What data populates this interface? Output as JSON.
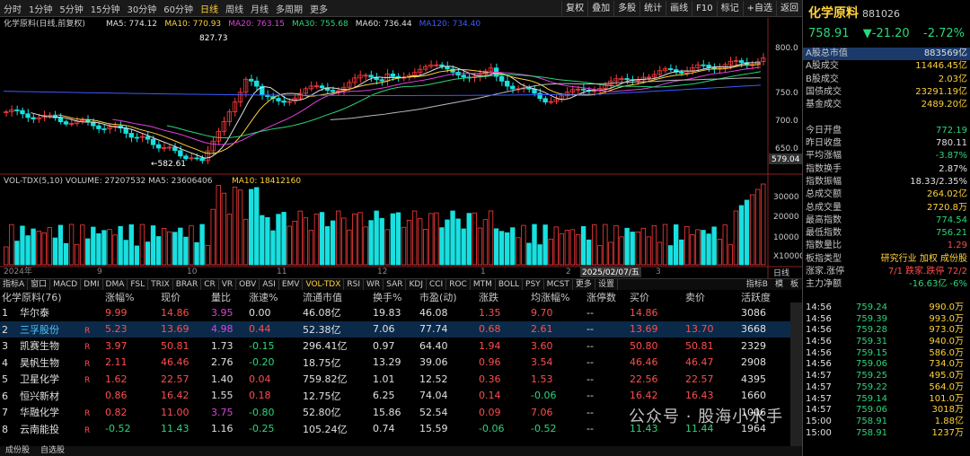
{
  "toolbar": {
    "timeframes": [
      "分时",
      "1分钟",
      "5分钟",
      "15分钟",
      "30分钟",
      "60分钟",
      "日线",
      "周线",
      "月线",
      "多周期",
      "更多"
    ],
    "active": 6,
    "tools": [
      "复权",
      "叠加",
      "多股",
      "统计",
      "画线",
      "F10",
      "标记",
      "+自选",
      "返回"
    ]
  },
  "chart": {
    "legend_main": "化学原料(日线,前复权)",
    "ma_labels": [
      {
        "text": "MA5: 774.12",
        "color": "#e0e0e0"
      },
      {
        "text": "MA10: 770.93",
        "color": "#ffd23a"
      },
      {
        "text": "MA20: 763.15",
        "color": "#e040e0"
      },
      {
        "text": "MA30: 755.68",
        "color": "#2bd67b"
      },
      {
        "text": "MA60: 736.44",
        "color": "#e0e0e0"
      },
      {
        "text": "MA120: 734.40",
        "color": "#3c5cff"
      }
    ],
    "high_label": "827.73",
    "low_label": "582.61",
    "y_ticks": [
      "800.0",
      "750.0",
      "700.0",
      "650.0",
      "600.0"
    ],
    "current_price": "579.04",
    "vol_legend": "VOL-TDX(5,10)  VOLUME: 27207532  MA5: 23606406",
    "vol_ma10": "MA10: 18412160",
    "vol_ticks": [
      "30000",
      "20000",
      "10000",
      "X10000"
    ],
    "x_labels": [
      "2024年",
      "9",
      "10",
      "11",
      "12",
      "1",
      "2",
      "3"
    ],
    "date_tag": "2025/02/07/五",
    "indicator_tabs": [
      "指标A",
      "窗口",
      "MACD",
      "DMI",
      "DMA",
      "FSL",
      "TRIX",
      "BRAR",
      "CR",
      "VR",
      "OBV",
      "ASI",
      "EMV",
      "VOL-TDX",
      "RSI",
      "WR",
      "SAR",
      "KDJ",
      "CCI",
      "ROC",
      "MTM",
      "BOLL",
      "PSY",
      "MCST",
      "更多",
      "设置"
    ],
    "right_tabs": [
      "指标B",
      "模",
      "板"
    ],
    "day_tab": "日线"
  },
  "stock": {
    "name": "化学原料",
    "code": "881026",
    "price": "758.91",
    "change": "▼-21.20",
    "pct": "-2.72%"
  },
  "stats": [
    {
      "k": "A股总市值",
      "v": "883569亿",
      "c": "wht",
      "hl": true
    },
    {
      "k": "A股成交",
      "v": "11446.45亿",
      "c": "yel"
    },
    {
      "k": "B股成交",
      "v": "2.03亿",
      "c": "yel"
    },
    {
      "k": "国债成交",
      "v": "23291.19亿",
      "c": "yel"
    },
    {
      "k": "基金成交",
      "v": "2489.20亿",
      "c": "yel"
    },
    {
      "k": "",
      "v": "",
      "c": "wht"
    },
    {
      "k": "今日开盘",
      "v": "772.19",
      "c": "grn"
    },
    {
      "k": "昨日收盘",
      "v": "780.11",
      "c": "wht"
    },
    {
      "k": "平均涨幅",
      "v": "-3.87%",
      "c": "grn"
    },
    {
      "k": "指数换手",
      "v": "2.87%",
      "c": "wht"
    },
    {
      "k": "指数振幅",
      "v": "18.33/2.35%",
      "c": "wht"
    },
    {
      "k": "总成交额",
      "v": "264.02亿",
      "c": "yel"
    },
    {
      "k": "总成交量",
      "v": "2720.8万",
      "c": "yel"
    },
    {
      "k": "最高指数",
      "v": "774.54",
      "c": "grn"
    },
    {
      "k": "最低指数",
      "v": "756.21",
      "c": "grn"
    },
    {
      "k": "指数量比",
      "v": "1.29",
      "c": "red"
    },
    {
      "k": "板指类型",
      "v": "研究行业 加权 成份股",
      "c": "yel"
    },
    {
      "k": "涨家.涨停",
      "v": "7/1  跌家.跌停  72/2",
      "c": "red"
    },
    {
      "k": "主力净额",
      "v": "-16.63亿  -6%",
      "c": "grn"
    }
  ],
  "table": {
    "headers": [
      "化学原料(76)",
      "涨幅%",
      "现价",
      "量比",
      "涨速%",
      "流通市值",
      "换手%",
      "市盈(动)",
      "涨跌",
      "均涨幅%",
      "涨停数",
      "买价",
      "卖价",
      "活跃度"
    ],
    "rows": [
      {
        "n": "1",
        "name": "华尔泰",
        "r": "",
        "v": [
          "9.99",
          "14.86",
          "3.95",
          "0.00",
          "46.08亿",
          "19.83",
          "46.08",
          "1.35",
          "9.70",
          "--",
          "14.86",
          "",
          "3086"
        ],
        "c": [
          "red",
          "red",
          "mag",
          "wht",
          "wht",
          "wht",
          "wht",
          "red",
          "red",
          "wht",
          "red",
          "wht",
          "wht"
        ]
      },
      {
        "n": "2",
        "name": "三孚股份",
        "r": "R",
        "v": [
          "5.23",
          "13.69",
          "4.98",
          "0.44",
          "52.38亿",
          "7.06",
          "77.74",
          "0.68",
          "2.61",
          "--",
          "13.69",
          "13.70",
          "3668"
        ],
        "c": [
          "red",
          "red",
          "mag",
          "red",
          "wht",
          "wht",
          "wht",
          "red",
          "red",
          "wht",
          "red",
          "red",
          "wht"
        ],
        "sel": true
      },
      {
        "n": "3",
        "name": "凯赛生物",
        "r": "R",
        "v": [
          "3.97",
          "50.81",
          "1.73",
          "-0.15",
          "296.41亿",
          "0.97",
          "64.40",
          "1.94",
          "3.60",
          "--",
          "50.80",
          "50.81",
          "2329"
        ],
        "c": [
          "red",
          "red",
          "wht",
          "grn",
          "wht",
          "wht",
          "wht",
          "red",
          "red",
          "wht",
          "red",
          "red",
          "wht"
        ]
      },
      {
        "n": "4",
        "name": "昊帆生物",
        "r": "R",
        "v": [
          "2.11",
          "46.46",
          "2.76",
          "-0.20",
          "18.75亿",
          "13.29",
          "39.06",
          "0.96",
          "3.54",
          "--",
          "46.46",
          "46.47",
          "2908"
        ],
        "c": [
          "red",
          "red",
          "wht",
          "grn",
          "wht",
          "wht",
          "wht",
          "red",
          "red",
          "wht",
          "red",
          "red",
          "wht"
        ]
      },
      {
        "n": "5",
        "name": "卫星化学",
        "r": "R",
        "v": [
          "1.62",
          "22.57",
          "1.40",
          "0.04",
          "759.82亿",
          "1.01",
          "12.52",
          "0.36",
          "1.53",
          "--",
          "22.56",
          "22.57",
          "4395"
        ],
        "c": [
          "red",
          "red",
          "wht",
          "red",
          "wht",
          "wht",
          "wht",
          "red",
          "red",
          "wht",
          "red",
          "red",
          "wht"
        ]
      },
      {
        "n": "6",
        "name": "恒兴新材",
        "r": "",
        "v": [
          "0.86",
          "16.42",
          "1.55",
          "0.18",
          "12.75亿",
          "6.25",
          "74.04",
          "0.14",
          "-0.06",
          "--",
          "16.42",
          "16.43",
          "1660"
        ],
        "c": [
          "red",
          "red",
          "wht",
          "red",
          "wht",
          "wht",
          "wht",
          "red",
          "grn",
          "wht",
          "red",
          "red",
          "wht"
        ]
      },
      {
        "n": "7",
        "name": "华融化学",
        "r": "R",
        "v": [
          "0.82",
          "11.00",
          "3.75",
          "-0.80",
          "52.80亿",
          "15.86",
          "52.54",
          "0.09",
          "7.06",
          "--",
          "",
          "",
          "1006"
        ],
        "c": [
          "red",
          "red",
          "mag",
          "grn",
          "wht",
          "wht",
          "wht",
          "red",
          "red",
          "wht",
          "red",
          "red",
          "wht"
        ]
      },
      {
        "n": "8",
        "name": "云南能投",
        "r": "R",
        "v": [
          "-0.52",
          "11.43",
          "1.16",
          "-0.25",
          "105.24亿",
          "0.74",
          "15.59",
          "-0.06",
          "-0.52",
          "--",
          "11.43",
          "11.44",
          "1964"
        ],
        "c": [
          "grn",
          "grn",
          "wht",
          "grn",
          "wht",
          "wht",
          "wht",
          "grn",
          "grn",
          "wht",
          "grn",
          "grn",
          "wht"
        ]
      }
    ]
  },
  "ticks": [
    {
      "t": "14:56",
      "p": "759.24",
      "v": "990.0万"
    },
    {
      "t": "14:56",
      "p": "759.39",
      "v": "993.0万"
    },
    {
      "t": "14:56",
      "p": "759.28",
      "v": "973.0万"
    },
    {
      "t": "14:56",
      "p": "759.31",
      "v": "940.0万"
    },
    {
      "t": "14:56",
      "p": "759.15",
      "v": "586.0万"
    },
    {
      "t": "14:56",
      "p": "759.06",
      "v": "734.0万"
    },
    {
      "t": "14:57",
      "p": "759.25",
      "v": "495.0万"
    },
    {
      "t": "14:57",
      "p": "759.22",
      "v": "564.0万"
    },
    {
      "t": "14:57",
      "p": "759.14",
      "v": "101.0万"
    },
    {
      "t": "14:57",
      "p": "759.06",
      "v": "3018万"
    },
    {
      "t": "15:00",
      "p": "758.91",
      "v": "1.88亿"
    },
    {
      "t": "15:00",
      "p": "758.91",
      "v": "1237万"
    }
  ],
  "bottom_tabs": [
    "成份股",
    "自选股"
  ],
  "watermark": "公众号 · 股海小水手"
}
